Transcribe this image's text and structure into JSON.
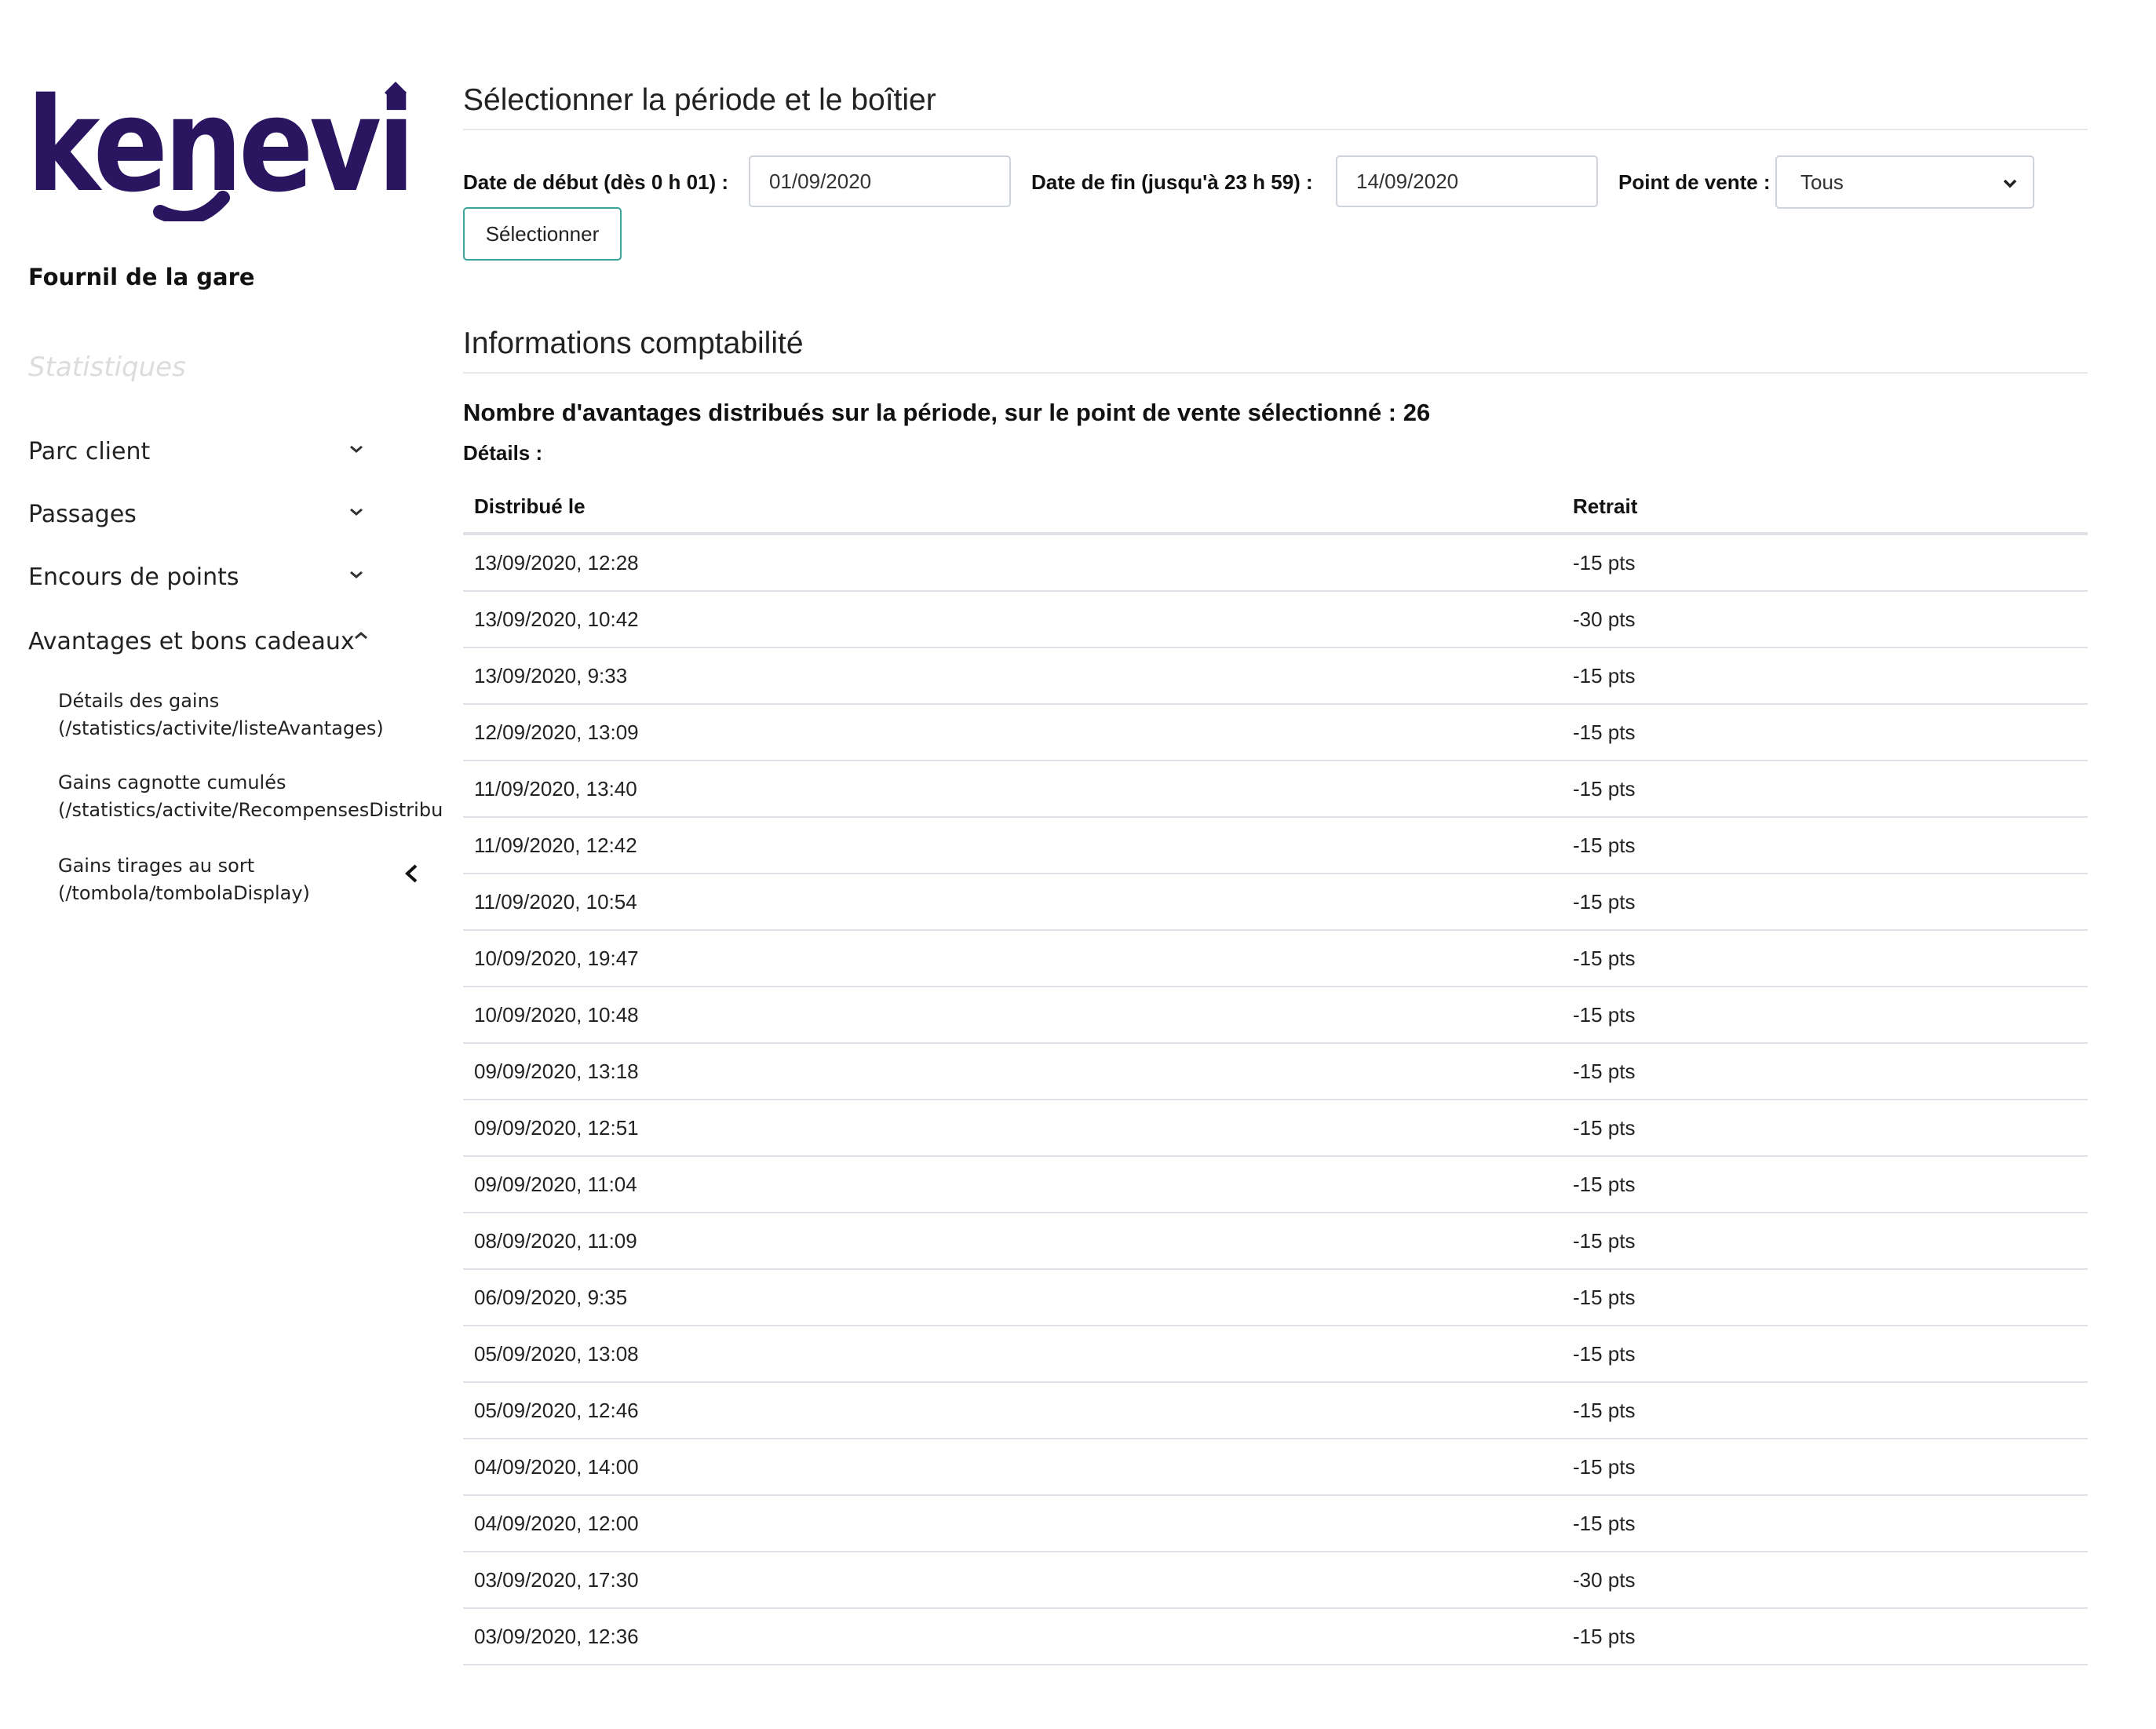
{
  "brand": {
    "logo_text": "kenevi",
    "logo_color": "#2a1560"
  },
  "sidebar": {
    "merchant_name": "Fournil de la gare",
    "section_title": "Statistiques",
    "nav": [
      {
        "label": "Parc client",
        "icon": "chevron-down-icon"
      },
      {
        "label": "Passages",
        "icon": "chevron-down-icon"
      },
      {
        "label": "Encours de points",
        "icon": "chevron-down-icon"
      },
      {
        "label": "Avantages et bons cadeaux",
        "icon": "chevron-up-icon"
      }
    ],
    "sub_items": [
      {
        "line1": "Détails des gains",
        "line2": "(/statistics/activite/listeAvantages)"
      },
      {
        "line1": "Gains cagnotte cumulés",
        "line2": "(/statistics/activite/RecompensesDistribu"
      },
      {
        "line1": "Gains tirages au sort",
        "line2": "(/tombola/tombolaDisplay)"
      }
    ],
    "collapse_icon": "chevron-left-icon"
  },
  "filters": {
    "heading": "Sélectionner la période et le boîtier",
    "start_label": "Date de début (dès 0 h 01) :",
    "start_value": "01/09/2020",
    "end_label": "Date de fin (jusqu'à 23 h 59) :",
    "end_value": "14/09/2020",
    "pos_label": "Point de vente :",
    "pos_selected": "Tous",
    "submit_label": "Sélectionner",
    "submit_border_color": "#3aa39a"
  },
  "accounting": {
    "heading": "Informations comptabilité",
    "summary": "Nombre d'avantages distribués sur la période, sur le point de vente sélectionné : 26",
    "details_label": "Détails :",
    "columns": [
      "Distribué le",
      "Retrait"
    ],
    "rows": [
      [
        "13/09/2020, 12:28",
        "-15 pts"
      ],
      [
        "13/09/2020, 10:42",
        "-30 pts"
      ],
      [
        "13/09/2020, 9:33",
        "-15 pts"
      ],
      [
        "12/09/2020, 13:09",
        "-15 pts"
      ],
      [
        "11/09/2020, 13:40",
        "-15 pts"
      ],
      [
        "11/09/2020, 12:42",
        "-15 pts"
      ],
      [
        "11/09/2020, 10:54",
        "-15 pts"
      ],
      [
        "10/09/2020, 19:47",
        "-15 pts"
      ],
      [
        "10/09/2020, 10:48",
        "-15 pts"
      ],
      [
        "09/09/2020, 13:18",
        "-15 pts"
      ],
      [
        "09/09/2020, 12:51",
        "-15 pts"
      ],
      [
        "09/09/2020, 11:04",
        "-15 pts"
      ],
      [
        "08/09/2020, 11:09",
        "-15 pts"
      ],
      [
        "06/09/2020, 9:35",
        "-15 pts"
      ],
      [
        "05/09/2020, 13:08",
        "-15 pts"
      ],
      [
        "05/09/2020, 12:46",
        "-15 pts"
      ],
      [
        "04/09/2020, 14:00",
        "-15 pts"
      ],
      [
        "04/09/2020, 12:00",
        "-15 pts"
      ],
      [
        "03/09/2020, 17:30",
        "-30 pts"
      ],
      [
        "03/09/2020, 12:36",
        "-15 pts"
      ]
    ]
  }
}
